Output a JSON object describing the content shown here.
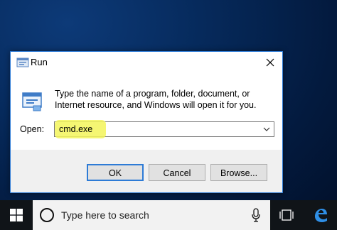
{
  "dialog": {
    "title": "Run",
    "description": "Type the name of a program, folder, document, or Internet resource, and Windows will open it for you.",
    "open_label": "Open:",
    "command_value": "cmd.exe",
    "buttons": {
      "ok": "OK",
      "cancel": "Cancel",
      "browse": "Browse..."
    }
  },
  "taskbar": {
    "search_placeholder": "Type here to search"
  },
  "colors": {
    "accent": "#2d7bd6",
    "highlight": "#f3f55a",
    "taskbar": "#101418"
  },
  "icons": [
    "run-icon",
    "close-icon",
    "chevron-down-icon",
    "windows-start-icon",
    "search-icon",
    "microphone-icon",
    "task-view-icon",
    "edge-icon"
  ]
}
